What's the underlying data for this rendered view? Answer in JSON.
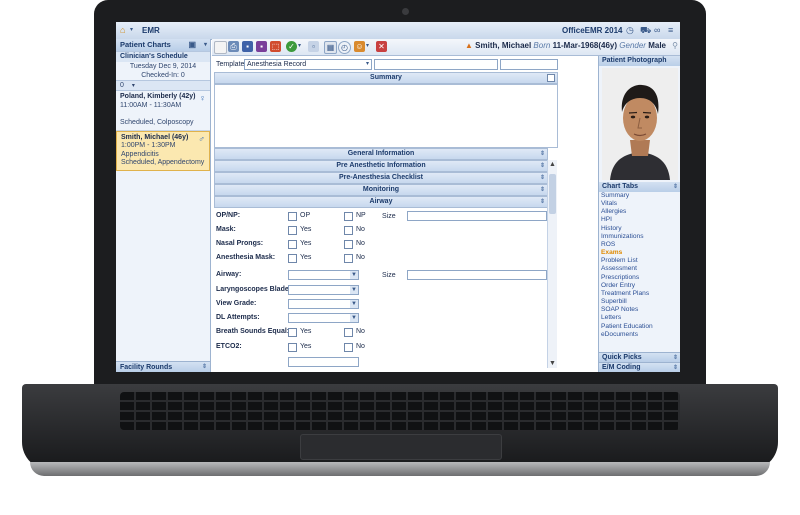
{
  "window": {
    "app_name": "EMR",
    "brand": "OfficeEMR 2014"
  },
  "patient_header": {
    "name": "Smith, Michael",
    "born_label": "Born",
    "dob_age": "11-Mar-1968(46y)",
    "gender_label": "Gender",
    "gender": "Male"
  },
  "left_panel": {
    "title": "Patient Charts",
    "schedule_title": "Clinician's Schedule",
    "date": "Tuesday Dec 9, 2014",
    "checked_in": "Checked-In: 0",
    "pager_value": "0",
    "appointments": [
      {
        "name": "Poland, Kimberly (42y)",
        "time": "11:00AM - 11:30AM",
        "reason": "",
        "status": "Scheduled, Colposcopy",
        "symbol": "♀"
      },
      {
        "name": "Smith, Michael (46y)",
        "time": "1:00PM - 1:30PM",
        "reason": "Appendicitis",
        "status": "Scheduled, Appendectomy",
        "symbol": "♂"
      }
    ],
    "footer": "Facility Rounds"
  },
  "main": {
    "template_label": "Template",
    "template_value": "Anesthesia Record",
    "summary_title": "Summary",
    "sections": [
      "General Information",
      "Pre Anesthetic Information",
      "Pre-Anesthesia Checklist",
      "Monitoring",
      "Airway"
    ],
    "fields": {
      "opnp": {
        "label": "OP/NP:",
        "opt1": "OP",
        "opt2": "NP",
        "size_label": "Size"
      },
      "mask": {
        "label": "Mask:",
        "yes": "Yes",
        "no": "No"
      },
      "nasal": {
        "label": "Nasal Prongs:",
        "yes": "Yes",
        "no": "No"
      },
      "anesthesia_mask": {
        "label": "Anesthesia Mask:",
        "yes": "Yes",
        "no": "No"
      },
      "airway": {
        "label": "Airway:",
        "size_label": "Size"
      },
      "laryngoscopes": {
        "label": "Laryngoscopes Blade:"
      },
      "view_grade": {
        "label": "View Grade:"
      },
      "dl_attempts": {
        "label": "DL Attempts:"
      },
      "breath_sounds": {
        "label": "Breath Sounds Equal:",
        "yes": "Yes",
        "no": "No"
      },
      "etco2": {
        "label": "ETCO2:",
        "yes": "Yes",
        "no": "No"
      }
    }
  },
  "right_panel": {
    "photo_title": "Patient Photograph",
    "tabs_title": "Chart Tabs",
    "tabs": [
      "Summary",
      "Vitals",
      "Allergies",
      "HPI",
      "History",
      "Immunizations",
      "ROS",
      "Exams",
      "Problem List",
      "Assessment",
      "Prescriptions",
      "Order Entry",
      "Treatment Plans",
      "Superbill",
      "SOAP Notes",
      "Letters",
      "Patient Education",
      "eDocuments"
    ],
    "active_tab": "Exams",
    "footer_1": "Quick Picks",
    "footer_2": "E/M Coding"
  }
}
